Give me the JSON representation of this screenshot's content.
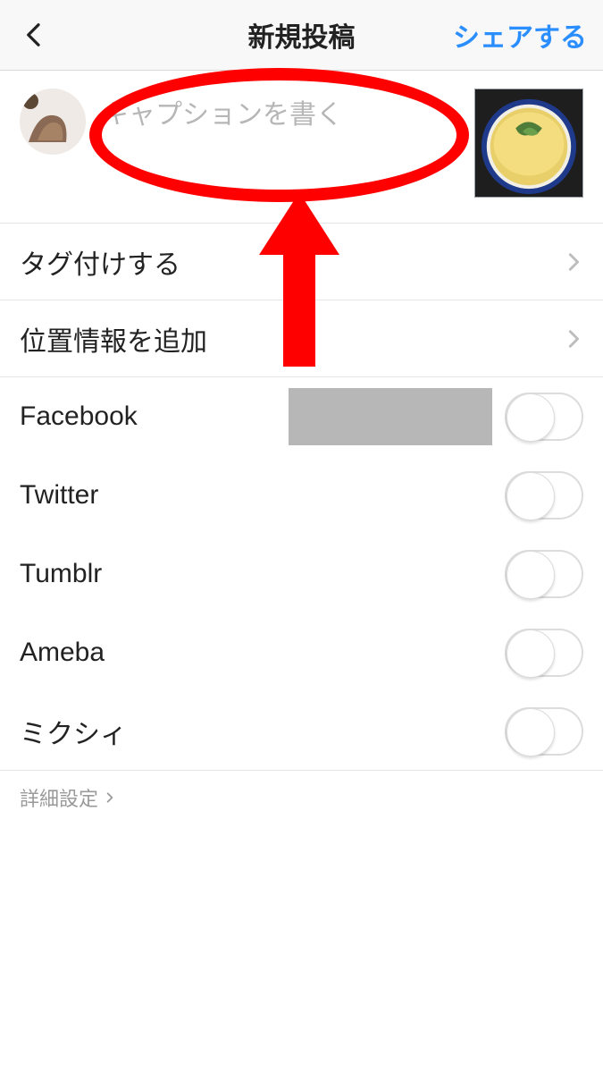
{
  "header": {
    "title": "新規投稿",
    "share_label": "シェアする"
  },
  "caption": {
    "placeholder": "キャプションを書く"
  },
  "rows": {
    "tag": "タグ付けする",
    "location": "位置情報を追加"
  },
  "share": {
    "items": [
      {
        "label": "Facebook"
      },
      {
        "label": "Twitter"
      },
      {
        "label": "Tumblr"
      },
      {
        "label": "Ameba"
      },
      {
        "label": "ミクシィ"
      }
    ]
  },
  "advanced": {
    "label": "詳細設定"
  }
}
